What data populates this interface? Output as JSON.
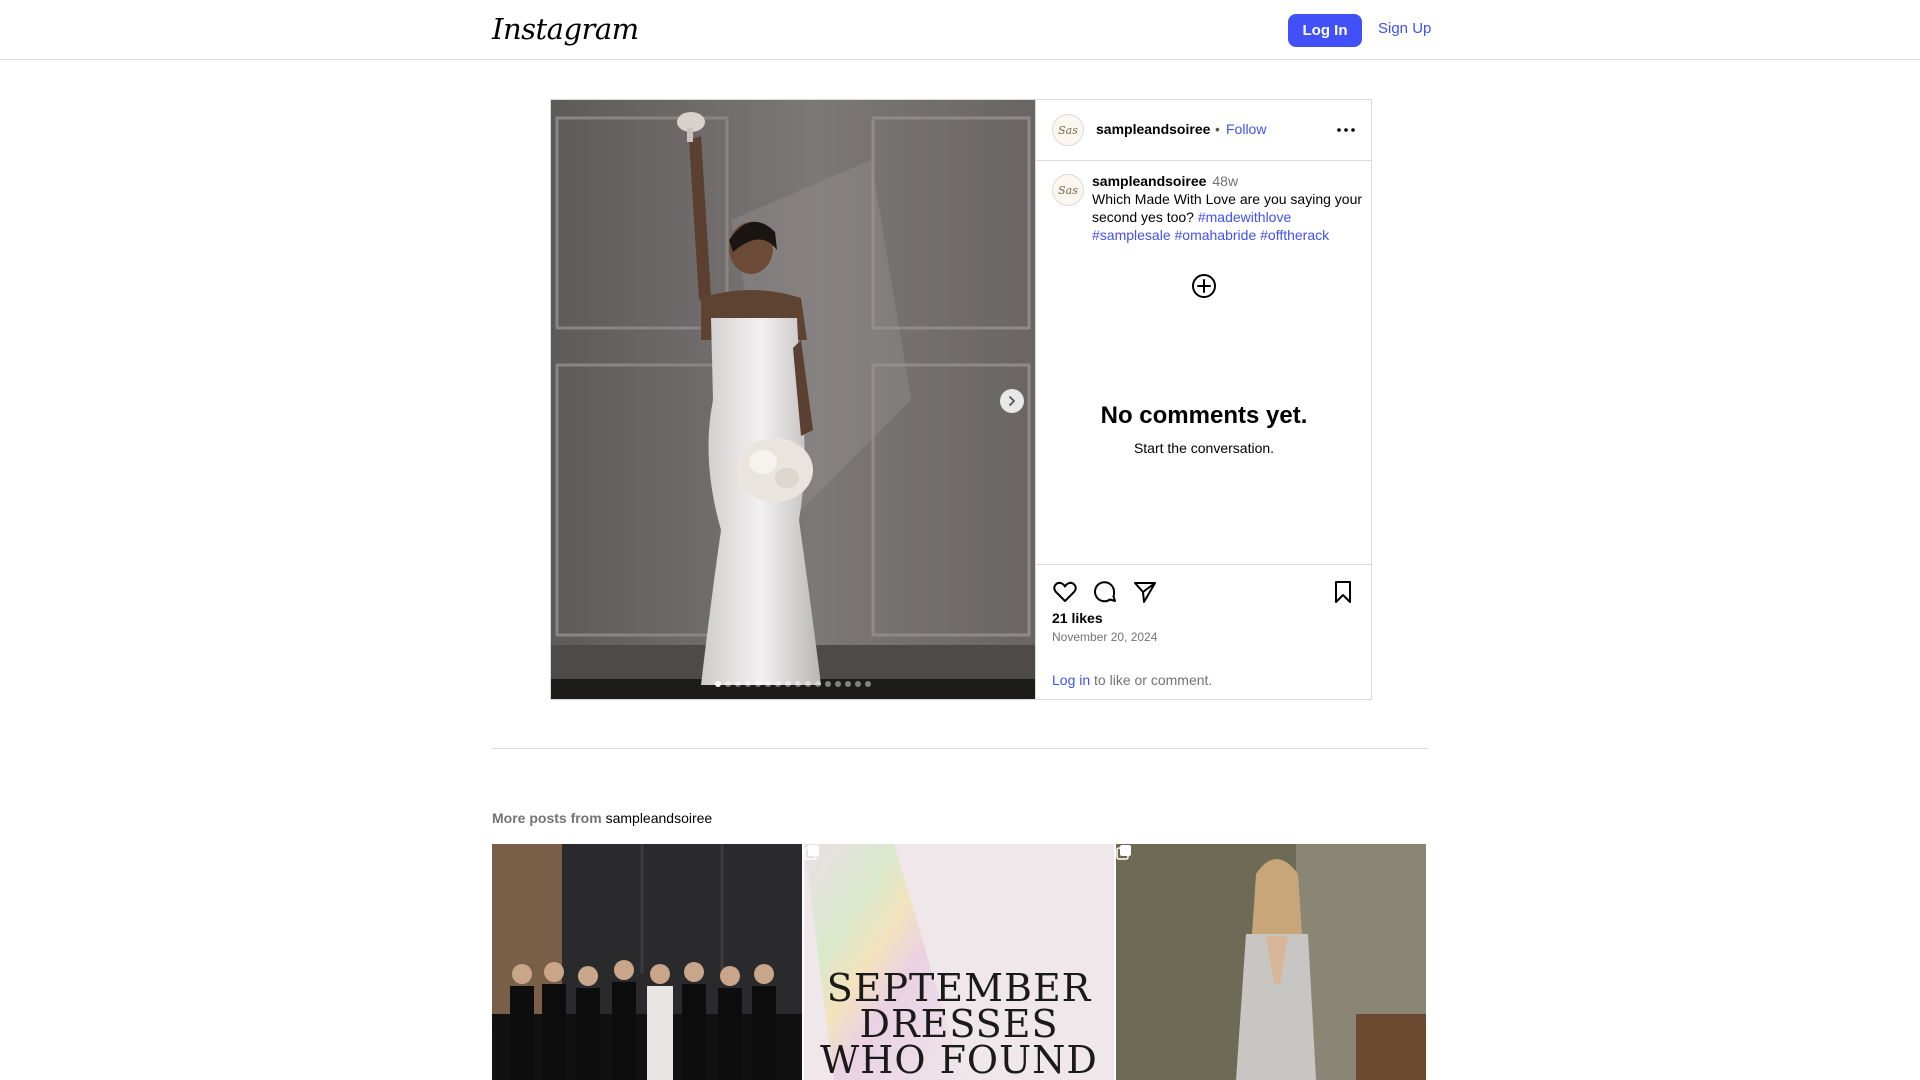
{
  "header": {
    "logo": "Instagram",
    "login_label": "Log In",
    "signup_label": "Sign Up"
  },
  "post": {
    "username": "sampleandsoiree",
    "avatar_text": "Sas",
    "separator": "•",
    "follow_label": "Follow",
    "more_icon": "more-horizontal-icon",
    "caption": {
      "username": "sampleandsoiree",
      "time": "48w",
      "text": "Which Made With Love are you saying your second yes too?",
      "hashtags": [
        "#madewithlove",
        "#samplesale",
        "#omahabride",
        "#offtherack"
      ]
    },
    "empty_title": "No comments yet.",
    "empty_subtitle": "Start the conversation.",
    "likes": "21 likes",
    "date": "November 20, 2024",
    "login_prompt_link": "Log in",
    "login_prompt_rest": " to like or comment.",
    "carousel": {
      "slides": 16,
      "current": 1
    }
  },
  "more_posts": {
    "prefix": "More posts from",
    "username": "sampleandsoiree",
    "tiles": [
      {
        "overlay_text": "",
        "multi": false
      },
      {
        "overlay_text": "SEPTEMBER DRESSES WHO FOUND",
        "multi": true
      },
      {
        "overlay_text": "",
        "multi": true
      }
    ]
  },
  "colors": {
    "accent": "#4150f7",
    "border": "#dbdbdb",
    "muted": "#737373"
  }
}
